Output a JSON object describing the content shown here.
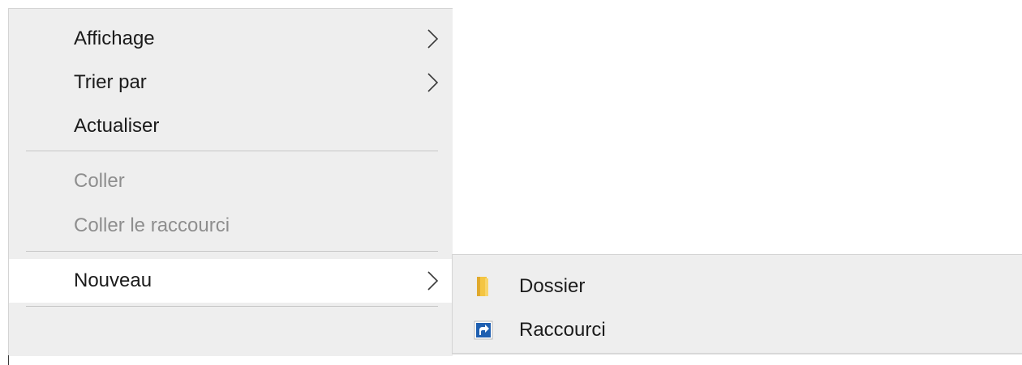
{
  "context_menu": {
    "items": [
      {
        "label": "Affichage",
        "has_submenu": true,
        "disabled": false
      },
      {
        "label": "Trier par",
        "has_submenu": true,
        "disabled": false
      },
      {
        "label": "Actualiser",
        "has_submenu": false,
        "disabled": false
      },
      {
        "label": "Coller",
        "has_submenu": false,
        "disabled": true
      },
      {
        "label": "Coller le raccourci",
        "has_submenu": false,
        "disabled": true
      },
      {
        "label": "Nouveau",
        "has_submenu": true,
        "disabled": false,
        "highlighted": true
      }
    ]
  },
  "submenu": {
    "items": [
      {
        "label": "Dossier",
        "icon": "folder-icon"
      },
      {
        "label": "Raccourci",
        "icon": "shortcut-icon"
      }
    ]
  },
  "colors": {
    "menu_background": "#eeeeee",
    "highlight_background": "#ffffff",
    "disabled_text": "#8e8e8e",
    "folder_yellow": "#f4c542",
    "shortcut_blue": "#1f5fb0"
  }
}
